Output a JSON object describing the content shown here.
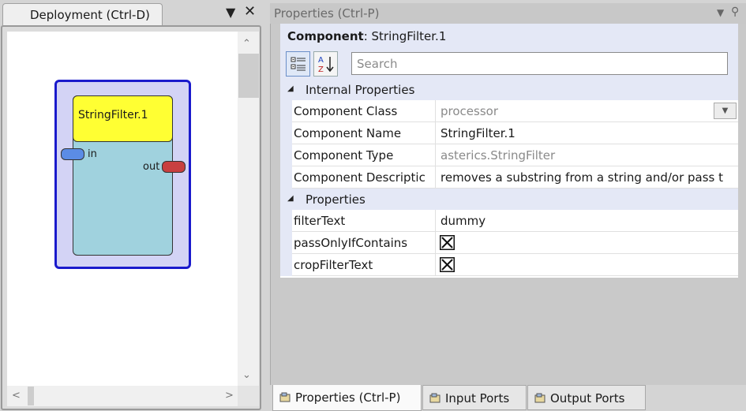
{
  "deployment": {
    "tab_label": "Deployment (Ctrl-D)",
    "component": {
      "title": "StringFilter.1",
      "in_port": "in",
      "out_port": "out"
    }
  },
  "properties": {
    "title": "Properties (Ctrl-P)",
    "component_label": "Component",
    "component_value": ": StringFilter.1",
    "search_placeholder": "Search",
    "categories": {
      "internal": "Internal Properties",
      "props": "Properties"
    },
    "internal_rows": [
      {
        "name": "Component Class",
        "value": "processor"
      },
      {
        "name": "Component Name",
        "value": "StringFilter.1"
      },
      {
        "name": "Component Type",
        "value": "asterics.StringFilter"
      },
      {
        "name": "Component Descriptic",
        "value": "removes a substring from a string and/or pass t"
      }
    ],
    "prop_rows": [
      {
        "name": "filterText",
        "value": "dummy"
      },
      {
        "name": "passOnlyIfContains",
        "checked": "x"
      },
      {
        "name": "cropFilterText",
        "checked": "x"
      }
    ]
  },
  "bottom_tabs": [
    {
      "label": "Properties (Ctrl-P)",
      "active": true
    },
    {
      "label": "Input Ports",
      "active": false
    },
    {
      "label": "Output Ports",
      "active": false
    }
  ],
  "colors": {
    "component_frame": "#1a1acc",
    "component_title": "#ffff33",
    "component_body": "#a0d2de",
    "in_port": "#5b8ce6",
    "out_port": "#c84040"
  }
}
